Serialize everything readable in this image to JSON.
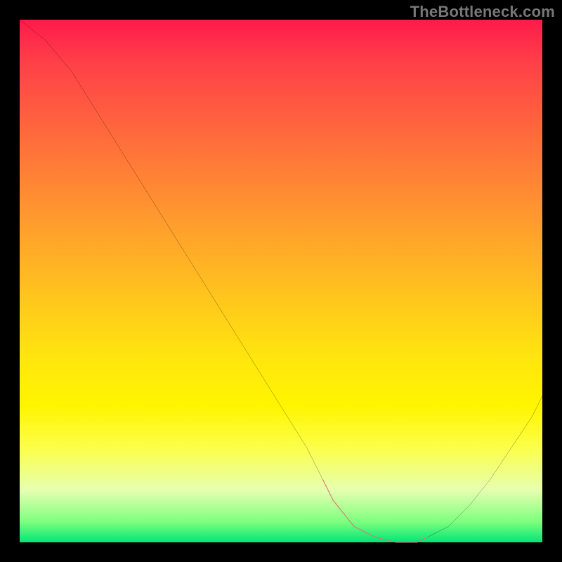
{
  "watermark": "TheBottleneck.com",
  "colors": {
    "frame": "#000000",
    "watermark_text": "#777777",
    "curve": "#000000",
    "highlight_segment": "#d9786e",
    "gradient_top": "#ff1a4b",
    "gradient_bottom": "#00e676"
  },
  "chart_data": {
    "type": "line",
    "title": "",
    "xlabel": "",
    "ylabel": "",
    "xlim": [
      0,
      100
    ],
    "ylim": [
      0,
      100
    ],
    "grid": false,
    "legend": false,
    "annotations": [],
    "series": [
      {
        "name": "curve",
        "x": [
          0,
          5,
          10,
          15,
          20,
          25,
          30,
          35,
          40,
          45,
          50,
          55,
          58,
          60,
          64,
          68,
          72,
          74,
          76,
          78,
          82,
          86,
          90,
          94,
          98,
          100
        ],
        "y": [
          100,
          96,
          90,
          82,
          74,
          66,
          58,
          50,
          42,
          34,
          26,
          18,
          12,
          8,
          3,
          1,
          0,
          0,
          0,
          1,
          3,
          7,
          12,
          18,
          24,
          28
        ]
      },
      {
        "name": "highlight-segment",
        "x": [
          58,
          60,
          64,
          68,
          72,
          74,
          76,
          78
        ],
        "y": [
          12,
          8,
          3,
          1,
          0,
          0,
          0,
          1
        ]
      }
    ]
  }
}
